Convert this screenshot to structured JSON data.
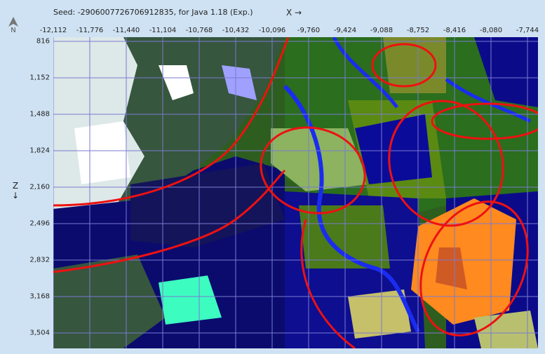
{
  "header": {
    "seed_label": "Seed: -2906007726706912835, for Java 1.18 (Exp.)",
    "x_axis_title": "X →",
    "z_axis_title": "Z",
    "z_axis_arrow": "↓",
    "north_label": "N"
  },
  "x_ticks": [
    "-12,112",
    "-11,776",
    "-11,440",
    "-11,104",
    "-10,768",
    "-10,432",
    "-10,096",
    "-9,760",
    "-9,424",
    "-9,088",
    "-8,752",
    "-8,416",
    "-8,080",
    "-7,744"
  ],
  "z_ticks": [
    "816",
    "1,152",
    "1,488",
    "1,824",
    "2,160",
    "2,496",
    "2,832",
    "3,168",
    "3,504"
  ],
  "colors": {
    "deep_ocean": "#0b0b6e",
    "dark_deep": "#14145a",
    "ocean": "#1010b0",
    "river": "#1a2cf0",
    "forest": "#2a6e1e",
    "plains": "#8db360",
    "jungle": "#5b8a12",
    "taiga": "#36563e",
    "snow": "#ffffff",
    "ice": "#a0a0ff",
    "beach": "#fade55",
    "warm_ocean": "#ff8a1f",
    "badlands": "#d05a24",
    "lush": "#3dfcc0",
    "structure_outline": "#ee1111",
    "grid": "#7a7ad0"
  }
}
